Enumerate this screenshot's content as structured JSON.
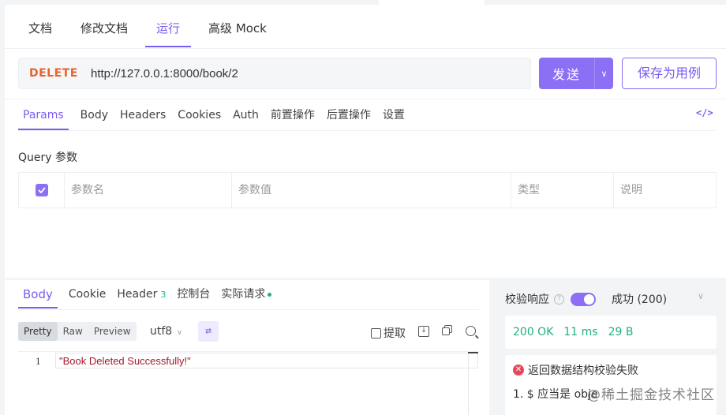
{
  "top_tabs": [
    {
      "label": "文档"
    },
    {
      "label": "修改文档"
    },
    {
      "label": "运行"
    },
    {
      "label": "高级 Mock"
    }
  ],
  "request": {
    "method": "DELETE",
    "url": "http://127.0.0.1:8000/book/2",
    "send_label": "发送",
    "save_label": "保存为用例"
  },
  "sub_tabs": [
    {
      "label": "Params"
    },
    {
      "label": "Body"
    },
    {
      "label": "Headers"
    },
    {
      "label": "Cookies"
    },
    {
      "label": "Auth"
    },
    {
      "label": "前置操作"
    },
    {
      "label": "后置操作"
    },
    {
      "label": "设置"
    }
  ],
  "code_toggle": "</>",
  "query": {
    "label": "Query 参数",
    "columns": [
      "参数名",
      "参数值",
      "类型",
      "说明"
    ]
  },
  "response_tabs": {
    "body": "Body",
    "cookie": "Cookie",
    "header": "Header",
    "header_count": "3",
    "console": "控制台",
    "actual_request": "实际请求"
  },
  "format": {
    "options": [
      "Pretty",
      "Raw",
      "Preview"
    ],
    "selected": "Pretty",
    "encoding": "utf8",
    "extract_label": "提取"
  },
  "editor": {
    "line_number": "1",
    "content": "\"Book Deleted Successfully!\""
  },
  "validation": {
    "label": "校验响应",
    "help": "?",
    "selected_status": "成功 (200)",
    "status_code": "200 OK",
    "time": "11 ms",
    "size": "29 B",
    "error_title": "返回数据结构校验失败",
    "error_detail": "1. $ 应当是 obje",
    "watermark": "@稀土掘金技术社区"
  },
  "colors": {
    "accent": "#7b5cf0",
    "method_delete": "#e5642e",
    "success": "#22b07d",
    "error": "#e8475b"
  }
}
